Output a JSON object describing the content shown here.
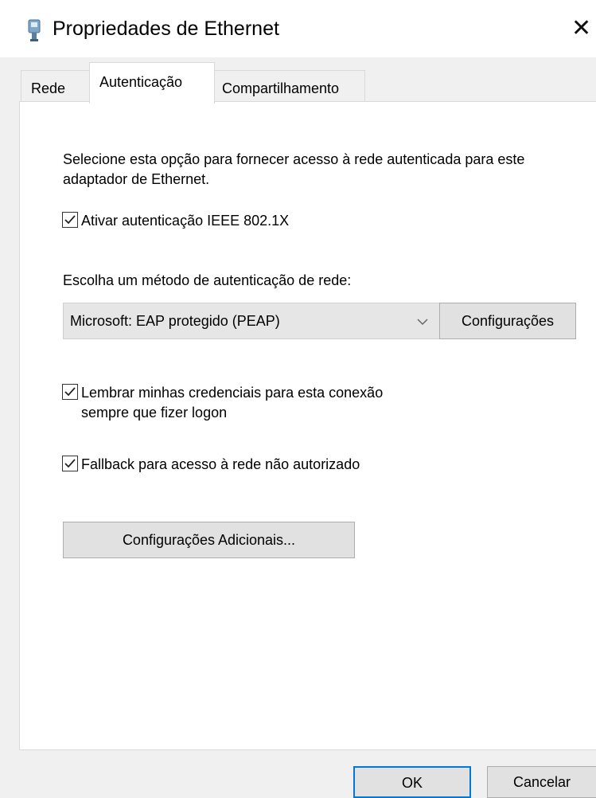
{
  "window": {
    "title": "Propriedades de Ethernet",
    "close_label": "✕",
    "icon": "network-adapter-icon",
    "accent_color": "#0078d7"
  },
  "tabs": [
    {
      "label": "Rede",
      "selected": false
    },
    {
      "label": "Autenticação",
      "selected": true
    },
    {
      "label": "Compartilhamento",
      "selected": false
    }
  ],
  "panel": {
    "description": "Selecione esta opção para fornecer acesso à rede autenticada para este adaptador de Ethernet.",
    "enable_8021x": {
      "label": "Ativar autenticação IEEE 802.1X",
      "checked": true
    },
    "method_label": "Escolha um método de autenticação de rede:",
    "method_select": {
      "value": "Microsoft: EAP protegido (PEAP)"
    },
    "settings_button": "Configurações",
    "remember_credentials": {
      "label": "Lembrar minhas credenciais para esta conexão\nsempre que fizer logon",
      "checked": true
    },
    "fallback": {
      "label": "Fallback para acesso à rede não autorizado",
      "checked": true
    },
    "additional_settings_button": "Configurações Adicionais..."
  },
  "footer": {
    "ok_label": "OK",
    "cancel_label": "Cancelar"
  }
}
